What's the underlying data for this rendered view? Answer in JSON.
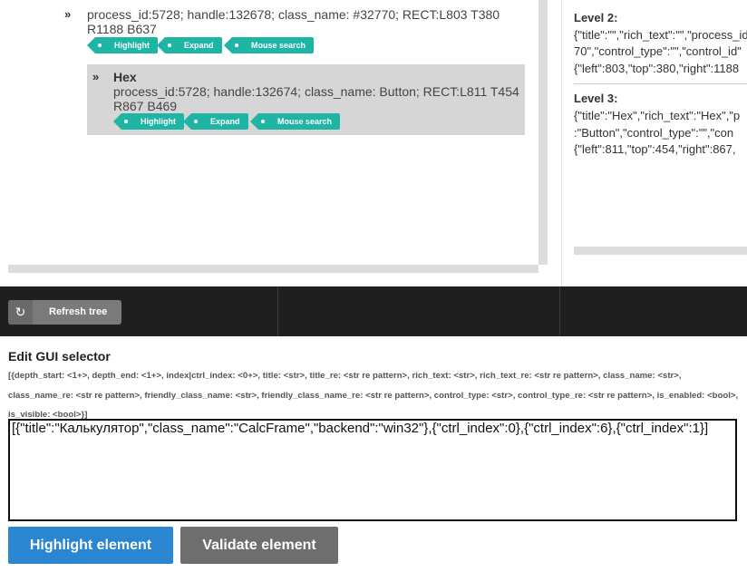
{
  "tree": {
    "node1": {
      "description": "process_id:5728; handle:132678; class_name: #32770; RECT:L803 T380 R1188 B637",
      "actions": [
        "Highlight",
        "Expand",
        "Mouse search"
      ]
    },
    "node2": {
      "title": "Hex",
      "description": "process_id:5728; handle:132674; class_name: Button; RECT:L811 T454 R867 B469",
      "actions": [
        "Highlight",
        "Expand",
        "Mouse search"
      ]
    }
  },
  "levels": [
    {
      "label": "Level 2:",
      "lines": [
        "{\"title\":\"\",\"rich_text\":\"\",\"process_id\"",
        "70\",\"control_type\":\"\",\"control_id\"",
        "{\"left\":803,\"top\":380,\"right\":1188"
      ]
    },
    {
      "label": "Level 3:",
      "lines": [
        "{\"title\":\"Hex\",\"rich_text\":\"Hex\",\"p",
        ":\"Button\",\"control_type\":\"\",\"con",
        "{\"left\":811,\"top\":454,\"right\":867,"
      ]
    }
  ],
  "toolbar": {
    "refresh_label": "Refresh tree",
    "refresh_icon": "refresh-icon"
  },
  "editor": {
    "title": "Edit GUI selector",
    "syntax_help": "[{depth_start: <1+>, depth_end: <1+>, index|ctrl_index: <0+>, title: <str>, title_re: <str re pattern>, rich_text: <str>, rich_text_re: <str re pattern>, class_name: <str>, class_name_re: <str re pattern>, friendly_class_name: <str>, friendly_class_name_re: <str re pattern>, control_type: <str>, control_type_re: <str re pattern>, is_enabled: <bool>, is_visible: <bool>}]",
    "selector_value": "[{\"title\":\"Калькулятор\",\"class_name\":\"CalcFrame\",\"backend\":\"win32\"},{\"ctrl_index\":0},{\"ctrl_index\":6},{\"ctrl_index\":1}]",
    "highlight_label": "Highlight element",
    "validate_label": "Validate element"
  },
  "colors": {
    "tag": "#1fb5a5",
    "highlight_button": "#2b86d1",
    "validate_button": "#6e6e6e",
    "toolbar": "#1f1f1f"
  }
}
